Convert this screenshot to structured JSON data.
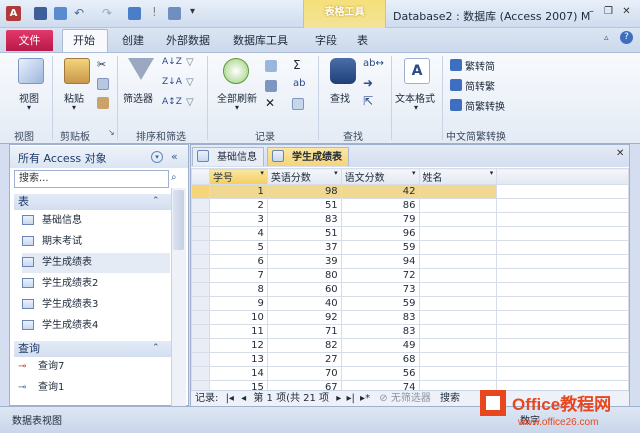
{
  "window": {
    "title": "Database2 : 数据库 (Access 2007) M",
    "context_tab_group": "表格工具"
  },
  "tabs": {
    "file": "文件",
    "home": "开始",
    "create": "创建",
    "external": "外部数据",
    "dbtools": "数据库工具",
    "fields": "字段",
    "table": "表"
  },
  "ribbon": {
    "view": {
      "button": "视图",
      "group": "视图"
    },
    "clipboard": {
      "paste": "粘贴",
      "group": "剪贴板"
    },
    "sort_filter": {
      "filter": "筛选器",
      "group": "排序和筛选"
    },
    "records": {
      "refresh": "全部刷新",
      "group": "记录"
    },
    "find": {
      "find": "查找",
      "group": "查找"
    },
    "text": {
      "format": "文本格式"
    },
    "chinese": {
      "to_simplified": "繁转简",
      "to_traditional": "简转繁",
      "convert": "简繁转换",
      "group": "中文简繁转换"
    }
  },
  "nav": {
    "title": "所有 Access 对象",
    "search_placeholder": "搜索...",
    "section_tables": "表",
    "tables": [
      "基础信息",
      "期末考试",
      "学生成绩表",
      "学生成绩表2",
      "学生成绩表3",
      "学生成绩表4"
    ],
    "section_queries": "查询",
    "queries": [
      "查询7",
      "查询1"
    ]
  },
  "doc": {
    "tabs": [
      "基础信息",
      "学生成绩表"
    ],
    "columns": [
      "学号",
      "英语分数",
      "语文分数",
      "姓名"
    ],
    "rows": [
      [
        "1",
        "98",
        "42"
      ],
      [
        "2",
        "51",
        "86"
      ],
      [
        "3",
        "83",
        "79"
      ],
      [
        "4",
        "51",
        "96"
      ],
      [
        "5",
        "37",
        "59"
      ],
      [
        "6",
        "39",
        "94"
      ],
      [
        "7",
        "80",
        "72"
      ],
      [
        "8",
        "60",
        "73"
      ],
      [
        "9",
        "40",
        "59"
      ],
      [
        "10",
        "92",
        "83"
      ],
      [
        "11",
        "71",
        "83"
      ],
      [
        "12",
        "82",
        "49"
      ],
      [
        "13",
        "27",
        "68"
      ],
      [
        "14",
        "70",
        "56"
      ],
      [
        "15",
        "67",
        "74"
      ]
    ]
  },
  "recbar": {
    "label": "记录:",
    "position": "第 1 项(共 21 项",
    "filter": "无筛选器",
    "search": "搜索"
  },
  "status": {
    "text": "数据表视图",
    "count_label": "数字"
  },
  "watermark": {
    "line1": "Office教程网",
    "line2": "www.office26.com"
  },
  "colors": {
    "file_tab": "#c8234f",
    "context_tab": "#f3dd7c",
    "selection": "#f3ce5e",
    "accent": "#1e3a66"
  }
}
